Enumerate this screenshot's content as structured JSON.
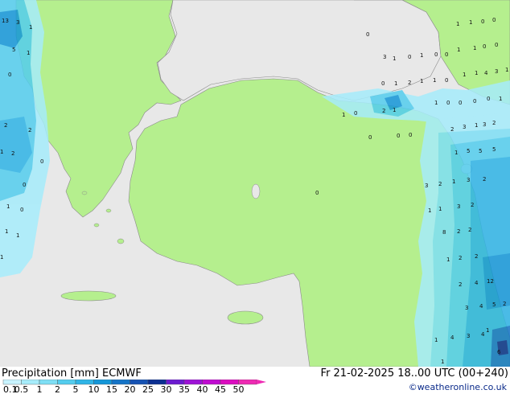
{
  "legend": {
    "title": "Precipitation [mm]  ECMWF",
    "datetime": "Fr 21-02-2025 18..00 UTC (00+240)",
    "credit": "©weatheronline.co.uk",
    "bins": [
      {
        "label": "0.1",
        "color": "#c8f3ff"
      },
      {
        "label": "0.5",
        "color": "#a6ecfb"
      },
      {
        "label": "1",
        "color": "#7fdff5"
      },
      {
        "label": "2",
        "color": "#54cdee"
      },
      {
        "label": "5",
        "color": "#2fb4e6"
      },
      {
        "label": "10",
        "color": "#1496d8"
      },
      {
        "label": "15",
        "color": "#1574c7"
      },
      {
        "label": "20",
        "color": "#1652b3"
      },
      {
        "label": "25",
        "color": "#0c2f91"
      },
      {
        "label": "30",
        "color": "#6c1bd0"
      },
      {
        "label": "35",
        "color": "#9d13d6"
      },
      {
        "label": "40",
        "color": "#c00bd1"
      },
      {
        "label": "45",
        "color": "#dc0dc0"
      },
      {
        "label": "50",
        "color": "#ee2ab3"
      }
    ]
  },
  "map_values": [
    {
      "v": "13"
    },
    {
      "v": "3"
    },
    {
      "v": "1"
    },
    {
      "v": "5"
    },
    {
      "v": "1"
    },
    {
      "v": "0"
    },
    {
      "v": "2"
    },
    {
      "v": "2"
    },
    {
      "v": "1"
    },
    {
      "v": "0"
    },
    {
      "v": "2"
    },
    {
      "v": "0"
    },
    {
      "v": "1"
    },
    {
      "v": "1"
    },
    {
      "v": "1"
    },
    {
      "v": "1"
    },
    {
      "v": "0"
    },
    {
      "v": "0"
    },
    {
      "v": "1"
    },
    {
      "v": "1"
    },
    {
      "v": "0"
    },
    {
      "v": "0"
    },
    {
      "v": "0"
    },
    {
      "v": "0"
    },
    {
      "v": "1"
    },
    {
      "v": "1"
    },
    {
      "v": "0"
    },
    {
      "v": "0"
    },
    {
      "v": "0"
    },
    {
      "v": "1"
    },
    {
      "v": "1"
    },
    {
      "v": "1"
    },
    {
      "v": "1"
    },
    {
      "v": "4"
    },
    {
      "v": "3"
    },
    {
      "v": "1"
    },
    {
      "v": "1"
    },
    {
      "v": "2"
    },
    {
      "v": "1"
    },
    {
      "v": "1"
    },
    {
      "v": "0"
    },
    {
      "v": "1"
    },
    {
      "v": "0"
    },
    {
      "v": "0"
    },
    {
      "v": "0"
    },
    {
      "v": "2"
    },
    {
      "v": "0"
    },
    {
      "v": "1"
    },
    {
      "v": "2"
    },
    {
      "v": "3"
    },
    {
      "v": "1"
    },
    {
      "v": "3"
    },
    {
      "v": "2"
    },
    {
      "v": "1"
    },
    {
      "v": "5"
    },
    {
      "v": "5"
    },
    {
      "v": "5"
    },
    {
      "v": "3"
    },
    {
      "v": "2"
    },
    {
      "v": "1"
    },
    {
      "v": "3"
    },
    {
      "v": "2"
    },
    {
      "v": "1"
    },
    {
      "v": "1"
    },
    {
      "v": "3"
    },
    {
      "v": "2"
    },
    {
      "v": "8"
    },
    {
      "v": "2"
    },
    {
      "v": "2"
    },
    {
      "v": "1"
    },
    {
      "v": "2"
    },
    {
      "v": "2"
    },
    {
      "v": "12"
    },
    {
      "v": "2"
    },
    {
      "v": "4"
    },
    {
      "v": "3"
    },
    {
      "v": "4"
    },
    {
      "v": "5"
    },
    {
      "v": "2"
    },
    {
      "v": "1"
    },
    {
      "v": "4"
    },
    {
      "v": "3"
    },
    {
      "v": "4"
    },
    {
      "v": "6"
    },
    {
      "v": "1"
    },
    {
      "v": "0"
    },
    {
      "v": "1"
    },
    {
      "v": "0"
    },
    {
      "v": "0"
    },
    {
      "v": "0"
    },
    {
      "v": "0"
    },
    {
      "v": "1"
    },
    {
      "v": "1"
    },
    {
      "v": "0"
    },
    {
      "v": "3"
    }
  ]
}
